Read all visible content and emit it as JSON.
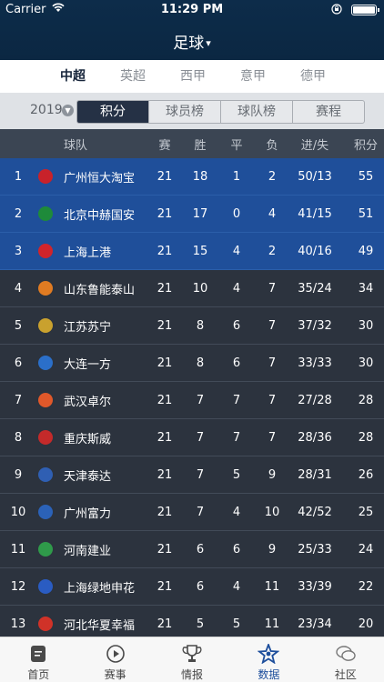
{
  "status_bar": {
    "carrier": "Carrier",
    "time": "11:29 PM"
  },
  "nav": {
    "title": "足球",
    "caret": "▾"
  },
  "league_tabs": [
    "中超",
    "英超",
    "西甲",
    "意甲",
    "德甲"
  ],
  "active_league_index": 0,
  "filter": {
    "season": "2019",
    "segments": [
      "积分",
      "球员榜",
      "球队榜",
      "赛程"
    ],
    "active_segment_index": 0
  },
  "table": {
    "headers": {
      "team": "球队",
      "played": "赛",
      "won": "胜",
      "drawn": "平",
      "lost": "负",
      "goals": "进/失",
      "points": "积分"
    },
    "rows": [
      {
        "rank": "1",
        "team": "广州恒大淘宝",
        "played": "21",
        "won": "18",
        "drawn": "1",
        "lost": "2",
        "goals": "50/13",
        "points": "55",
        "logo_color": "#c8222a",
        "highlight": true
      },
      {
        "rank": "2",
        "team": "北京中赫国安",
        "played": "21",
        "won": "17",
        "drawn": "0",
        "lost": "4",
        "goals": "41/15",
        "points": "51",
        "logo_color": "#1e8a3a",
        "highlight": true
      },
      {
        "rank": "3",
        "team": "上海上港",
        "played": "21",
        "won": "15",
        "drawn": "4",
        "lost": "2",
        "goals": "40/16",
        "points": "49",
        "logo_color": "#d1242b",
        "highlight": true
      },
      {
        "rank": "4",
        "team": "山东鲁能泰山",
        "played": "21",
        "won": "10",
        "drawn": "4",
        "lost": "7",
        "goals": "35/24",
        "points": "34",
        "logo_color": "#e07b22",
        "highlight": false
      },
      {
        "rank": "5",
        "team": "江苏苏宁",
        "played": "21",
        "won": "8",
        "drawn": "6",
        "lost": "7",
        "goals": "37/32",
        "points": "30",
        "logo_color": "#c9a12e",
        "highlight": false
      },
      {
        "rank": "6",
        "team": "大连一方",
        "played": "21",
        "won": "8",
        "drawn": "6",
        "lost": "7",
        "goals": "33/33",
        "points": "30",
        "logo_color": "#2b6fc9",
        "highlight": false
      },
      {
        "rank": "7",
        "team": "武汉卓尔",
        "played": "21",
        "won": "7",
        "drawn": "7",
        "lost": "7",
        "goals": "27/28",
        "points": "28",
        "logo_color": "#e0582a",
        "highlight": false
      },
      {
        "rank": "8",
        "team": "重庆斯威",
        "played": "21",
        "won": "7",
        "drawn": "7",
        "lost": "7",
        "goals": "28/36",
        "points": "28",
        "logo_color": "#c42a2a",
        "highlight": false
      },
      {
        "rank": "9",
        "team": "天津泰达",
        "played": "21",
        "won": "7",
        "drawn": "5",
        "lost": "9",
        "goals": "28/31",
        "points": "26",
        "logo_color": "#2f5fb3",
        "highlight": false
      },
      {
        "rank": "10",
        "team": "广州富力",
        "played": "21",
        "won": "7",
        "drawn": "4",
        "lost": "10",
        "goals": "42/52",
        "points": "25",
        "logo_color": "#2b62b8",
        "highlight": false
      },
      {
        "rank": "11",
        "team": "河南建业",
        "played": "21",
        "won": "6",
        "drawn": "6",
        "lost": "9",
        "goals": "25/33",
        "points": "24",
        "logo_color": "#2f9a4a",
        "highlight": false
      },
      {
        "rank": "12",
        "team": "上海绿地申花",
        "played": "21",
        "won": "6",
        "drawn": "4",
        "lost": "11",
        "goals": "33/39",
        "points": "22",
        "logo_color": "#2a5cc2",
        "highlight": false
      },
      {
        "rank": "13",
        "team": "河北华夏幸福",
        "played": "21",
        "won": "5",
        "drawn": "5",
        "lost": "11",
        "goals": "23/34",
        "points": "20",
        "logo_color": "#d03228",
        "highlight": false
      }
    ]
  },
  "tab_bar": [
    {
      "label": "首页",
      "icon": "news-icon"
    },
    {
      "label": "赛事",
      "icon": "play-icon"
    },
    {
      "label": "情报",
      "icon": "trophy-icon"
    },
    {
      "label": "数据",
      "icon": "stats-star-icon"
    },
    {
      "label": "社区",
      "icon": "chat-bubbles-icon"
    }
  ],
  "active_tab_index": 3,
  "colors": {
    "nav_bg": "#0b2742",
    "highlight_row": "#1f4f9a",
    "row_bg": "#2c333e",
    "accent": "#1d4e9c"
  }
}
